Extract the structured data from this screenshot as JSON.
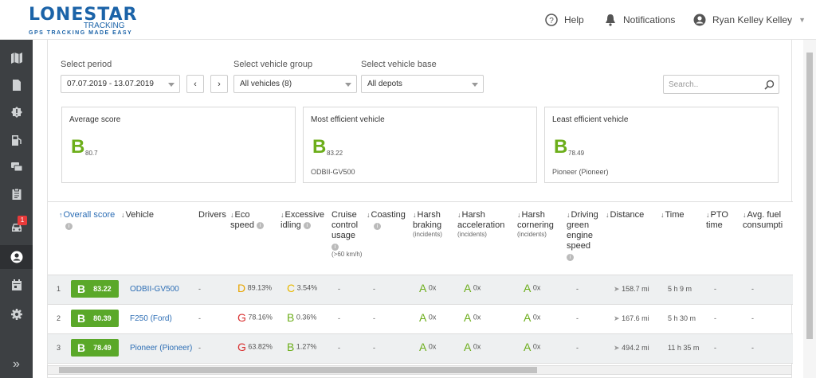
{
  "brand": {
    "name": "LONESTAR",
    "sub": "TRACKING",
    "tagline": "GPS TRACKING MADE EASY",
    "color": "#1b63a8"
  },
  "header": {
    "help": "Help",
    "notifications": "Notifications",
    "user": "Ryan Kelley Kelley"
  },
  "sidebar": {
    "items": [
      "map-icon",
      "document-icon",
      "alert-icon",
      "fuel-icon",
      "chat-icon",
      "clipboard-icon",
      "car-icon",
      "driver-icon",
      "calendar-icon",
      "gear-icon"
    ],
    "badge": "1",
    "active": "driver-icon",
    "expand": "»"
  },
  "filters": {
    "period_label": "Select period",
    "period_value": "07.07.2019 - 13.07.2019",
    "prev": "‹",
    "next": "›",
    "group_label": "Select vehicle group",
    "group_value": "All vehicles (8)",
    "base_label": "Select vehicle base",
    "base_value": "All depots",
    "search_placeholder": "Search.."
  },
  "cards": [
    {
      "title": "Average score",
      "grade": "B",
      "score": "80.7",
      "vehicle": ""
    },
    {
      "title": "Most efficient vehicle",
      "grade": "B",
      "score": "83.22",
      "vehicle": "ODBII-GV500"
    },
    {
      "title": "Least efficient vehicle",
      "grade": "B",
      "score": "78.49",
      "vehicle": "Pioneer (Pioneer)"
    }
  ],
  "columns": {
    "overall": "Overall score",
    "vehicle": "Vehicle",
    "drivers": "Drivers",
    "eco": "Eco speed",
    "idling": "Excessive idling",
    "cruise": "Cruise control usage",
    "cruise_note": "(>60 km/h)",
    "coasting": "Coasting",
    "braking": "Harsh braking",
    "incidents": "(incidents)",
    "accel": "Harsh acceleration",
    "cornering": "Harsh cornering",
    "green": "Driving green engine speed",
    "distance": "Distance",
    "time": "Time",
    "pto": "PTO time",
    "fuel": "Avg. fuel consumpti"
  },
  "rows": [
    {
      "n": "1",
      "grade": "B",
      "score": "83.22",
      "vehicle": "ODBII-GV500",
      "drivers": "-",
      "eco_g": "D",
      "eco": "89.13%",
      "idle_g": "C",
      "idle": "3.54%",
      "cruise": "-",
      "coast": "-",
      "brake_g": "A",
      "brake": "0x",
      "acc_g": "A",
      "acc": "0x",
      "corn_g": "A",
      "corn": "0x",
      "green": "-",
      "distance": "158.7 mi",
      "time": "5 h 9 m",
      "pto": "-",
      "fuel": "-"
    },
    {
      "n": "2",
      "grade": "B",
      "score": "80.39",
      "vehicle": "F250 (Ford)",
      "drivers": "-",
      "eco_g": "G",
      "eco": "78.16%",
      "idle_g": "B",
      "idle": "0.36%",
      "cruise": "-",
      "coast": "-",
      "brake_g": "A",
      "brake": "0x",
      "acc_g": "A",
      "acc": "0x",
      "corn_g": "A",
      "corn": "0x",
      "green": "-",
      "distance": "167.6 mi",
      "time": "5 h 30 m",
      "pto": "-",
      "fuel": "-"
    },
    {
      "n": "3",
      "grade": "B",
      "score": "78.49",
      "vehicle": "Pioneer (Pioneer)",
      "drivers": "-",
      "eco_g": "G",
      "eco": "63.82%",
      "idle_g": "B",
      "idle": "1.27%",
      "cruise": "-",
      "coast": "-",
      "brake_g": "A",
      "brake": "0x",
      "acc_g": "A",
      "acc": "0x",
      "corn_g": "A",
      "corn": "0x",
      "green": "-",
      "distance": "494.2 mi",
      "time": "11 h 35 m",
      "pto": "-",
      "fuel": "-"
    }
  ]
}
